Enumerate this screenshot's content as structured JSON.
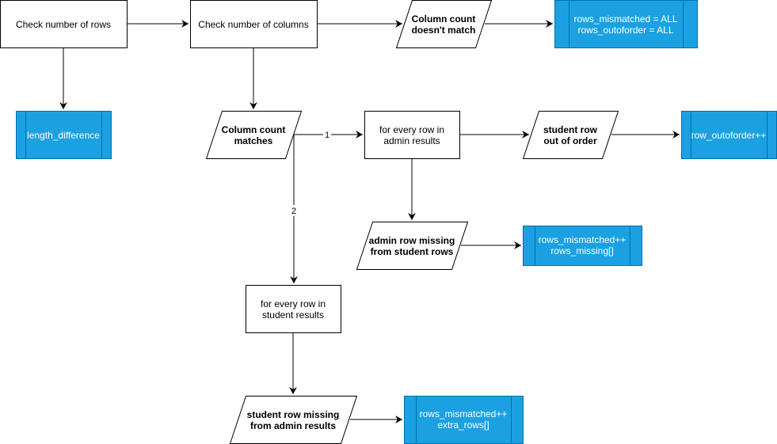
{
  "colors": {
    "process_fill": "#ffffff",
    "stroke": "#000000",
    "subprocess_fill": "#1ba1e2",
    "subprocess_stroke": "#006eaf",
    "subprocess_text": "#ffffff"
  },
  "nodes": {
    "check_rows": {
      "type": "process",
      "lines": [
        "Check number of rows"
      ]
    },
    "check_columns": {
      "type": "process",
      "lines": [
        "Check number of columns"
      ]
    },
    "col_mismatch": {
      "type": "data",
      "lines": [
        "Column count",
        "doesn't match"
      ]
    },
    "set_all": {
      "type": "subprocess",
      "lines": [
        "rows_mismatched = ALL",
        "rows_outoforder = ALL"
      ]
    },
    "length_difference": {
      "type": "subprocess",
      "lines": [
        "length_difference"
      ]
    },
    "col_match": {
      "type": "data",
      "lines": [
        "Column count",
        "matches"
      ]
    },
    "loop_admin": {
      "type": "process",
      "lines": [
        "for every row in",
        "admin results"
      ]
    },
    "student_out_of_order": {
      "type": "data",
      "lines": [
        "student row",
        "out of order"
      ]
    },
    "row_outoforder": {
      "type": "subprocess",
      "lines": [
        "row_outoforder++"
      ]
    },
    "admin_missing": {
      "type": "data",
      "lines": [
        "admin row missing",
        "from student rows"
      ]
    },
    "rows_missing": {
      "type": "subprocess",
      "lines": [
        "rows_mismatched++",
        "rows_missing[]"
      ]
    },
    "loop_student": {
      "type": "process",
      "lines": [
        "for every row in",
        "student results"
      ]
    },
    "student_missing": {
      "type": "data",
      "lines": [
        "student row missing",
        "from admin results"
      ]
    },
    "extra_rows": {
      "type": "subprocess",
      "lines": [
        "rows_mismatched++",
        "extra_rows[]"
      ]
    }
  },
  "edges": [
    {
      "from": "check_rows",
      "to": "check_columns",
      "label": ""
    },
    {
      "from": "check_rows",
      "to": "length_difference",
      "label": ""
    },
    {
      "from": "check_columns",
      "to": "col_mismatch",
      "label": ""
    },
    {
      "from": "col_mismatch",
      "to": "set_all",
      "label": ""
    },
    {
      "from": "check_columns",
      "to": "col_match",
      "label": ""
    },
    {
      "from": "col_match",
      "to": "loop_admin",
      "label": "1"
    },
    {
      "from": "col_match",
      "to": "loop_student",
      "label": "2"
    },
    {
      "from": "loop_admin",
      "to": "student_out_of_order",
      "label": ""
    },
    {
      "from": "student_out_of_order",
      "to": "row_outoforder",
      "label": ""
    },
    {
      "from": "loop_admin",
      "to": "admin_missing",
      "label": ""
    },
    {
      "from": "admin_missing",
      "to": "rows_missing",
      "label": ""
    },
    {
      "from": "loop_student",
      "to": "student_missing",
      "label": ""
    },
    {
      "from": "student_missing",
      "to": "extra_rows",
      "label": ""
    }
  ]
}
